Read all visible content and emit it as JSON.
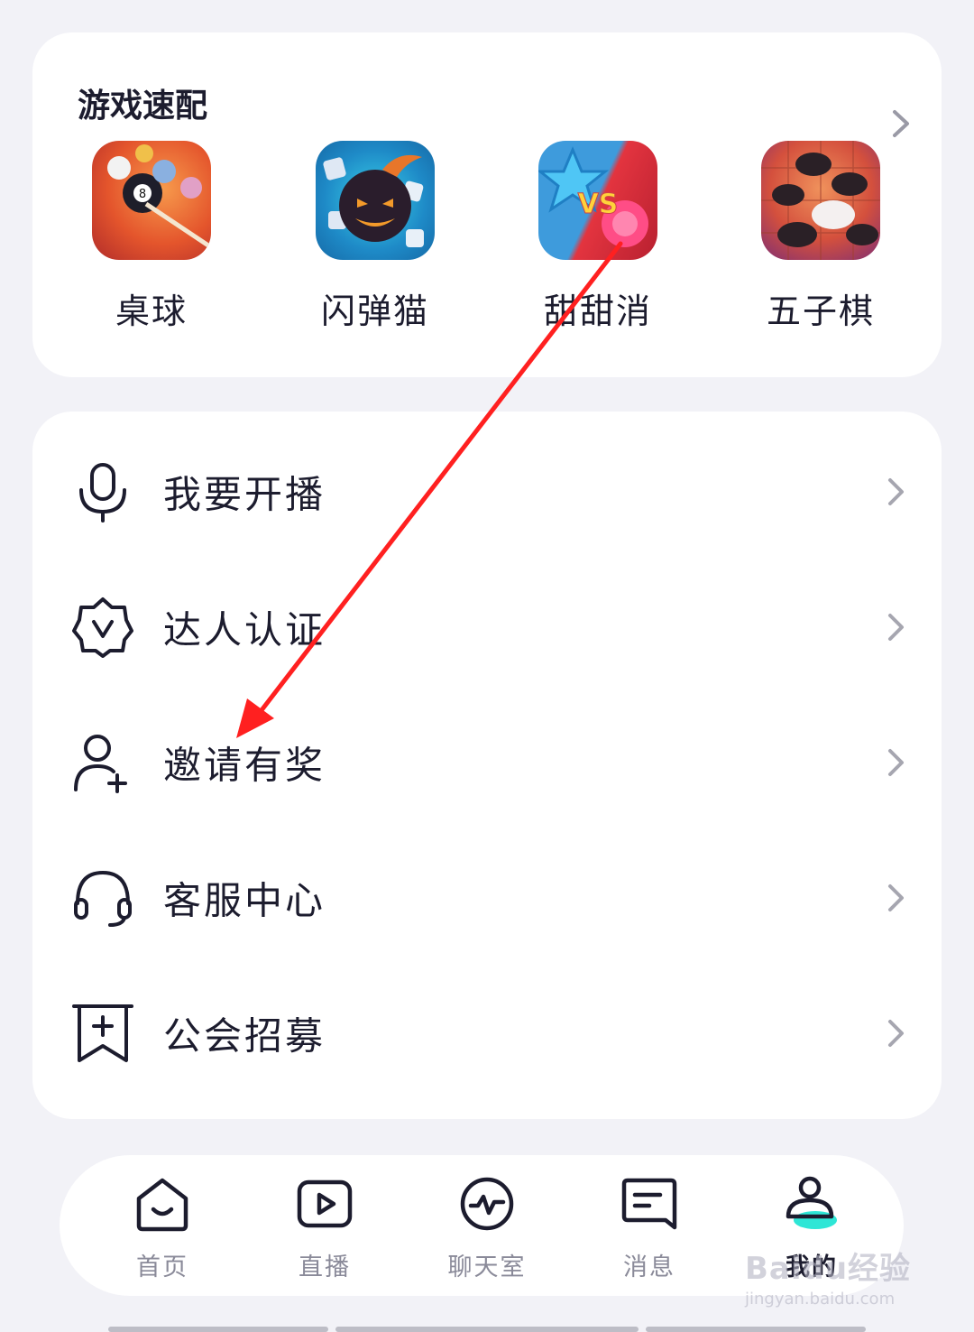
{
  "games": {
    "title": "游戏速配",
    "items": [
      {
        "name": "桌球",
        "icon": "billiards-icon"
      },
      {
        "name": "闪弹猫",
        "icon": "bomb-cat-icon"
      },
      {
        "name": "甜甜消",
        "icon": "sweet-match-icon"
      },
      {
        "name": "五子棋",
        "icon": "gomoku-icon"
      }
    ]
  },
  "menu": {
    "items": [
      {
        "label": "我要开播",
        "icon": "microphone-icon"
      },
      {
        "label": "达人认证",
        "icon": "verified-badge-icon"
      },
      {
        "label": "邀请有奖",
        "icon": "add-user-icon"
      },
      {
        "label": "客服中心",
        "icon": "headset-icon"
      },
      {
        "label": "公会招募",
        "icon": "guild-flag-icon"
      }
    ]
  },
  "nav": {
    "items": [
      {
        "label": "首页",
        "icon": "home-icon"
      },
      {
        "label": "直播",
        "icon": "live-play-icon"
      },
      {
        "label": "聊天室",
        "icon": "chatroom-pulse-icon"
      },
      {
        "label": "消息",
        "icon": "message-icon"
      },
      {
        "label": "我的",
        "icon": "profile-icon"
      }
    ],
    "active": "我的"
  },
  "watermark": {
    "main": "Baidu经验",
    "sub": "jingyan.baidu.com"
  },
  "colors": {
    "annotation_arrow": "#ff2020",
    "accent": "#2ee6d6",
    "text": "#1c1c2e"
  }
}
